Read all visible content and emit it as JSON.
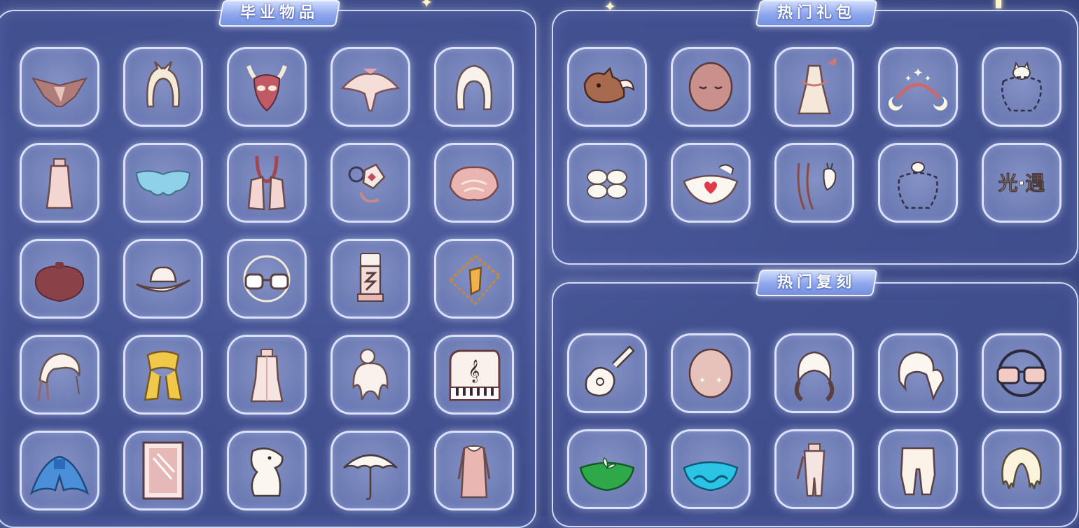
{
  "sections": {
    "graduation": {
      "title": "毕业物品",
      "items": [
        {
          "icon": "bat-cape-icon"
        },
        {
          "icon": "hair-ears-icon"
        },
        {
          "icon": "horned-mask-icon"
        },
        {
          "icon": "winged-cape-icon"
        },
        {
          "icon": "hood-hair-icon"
        },
        {
          "icon": "dress-outfit-icon"
        },
        {
          "icon": "butterfly-cape-icon"
        },
        {
          "icon": "scarf-outfit-icon"
        },
        {
          "icon": "prop-ornament-icon"
        },
        {
          "icon": "shell-cape-icon"
        },
        {
          "icon": "round-cape-icon"
        },
        {
          "icon": "cowboy-hat-icon"
        },
        {
          "icon": "glasses-icon"
        },
        {
          "icon": "lantern-prop-icon"
        },
        {
          "icon": "crystal-necklace-icon"
        },
        {
          "icon": "feather-hair-icon"
        },
        {
          "icon": "yellow-scarf-icon"
        },
        {
          "icon": "robe-outfit-icon"
        },
        {
          "icon": "bun-hair-icon"
        },
        {
          "icon": "piano-icon"
        },
        {
          "icon": "blue-cape-icon"
        },
        {
          "icon": "poster-frame-icon"
        },
        {
          "icon": "moomin-icon"
        },
        {
          "icon": "umbrella-icon"
        },
        {
          "icon": "coat-outfit-icon"
        }
      ]
    },
    "hot_gifts": {
      "title": "热门礼包",
      "items": [
        {
          "icon": "fox-cape-icon"
        },
        {
          "icon": "sleepy-mask-icon"
        },
        {
          "icon": "dress-with-wings-icon"
        },
        {
          "icon": "star-moon-headband-icon"
        },
        {
          "icon": "cat-outline-prop-icon"
        },
        {
          "icon": "clover-cape-icon"
        },
        {
          "icon": "heart-cape-icon"
        },
        {
          "icon": "cat-ear-hair-icon"
        },
        {
          "icon": "dashed-outline-prop-icon"
        }
      ],
      "logo_text": "光·遇"
    },
    "hot_reruns": {
      "title": "热门复刻",
      "items": [
        {
          "icon": "guitar-icon"
        },
        {
          "icon": "blush-mask-icon"
        },
        {
          "icon": "twin-tail-hair-icon"
        },
        {
          "icon": "ponytail-hair-icon"
        },
        {
          "icon": "sunglasses-icon"
        },
        {
          "icon": "leaf-cape-icon"
        },
        {
          "icon": "wave-cape-icon"
        },
        {
          "icon": "robe-pants-icon"
        },
        {
          "icon": "pants-icon"
        },
        {
          "icon": "curly-hair-icon"
        }
      ]
    }
  },
  "colors": {
    "background": "#3f4d8a",
    "cell": "#6f7db6",
    "frame": "#e1e8ff",
    "tag": "#8ea6ec"
  }
}
